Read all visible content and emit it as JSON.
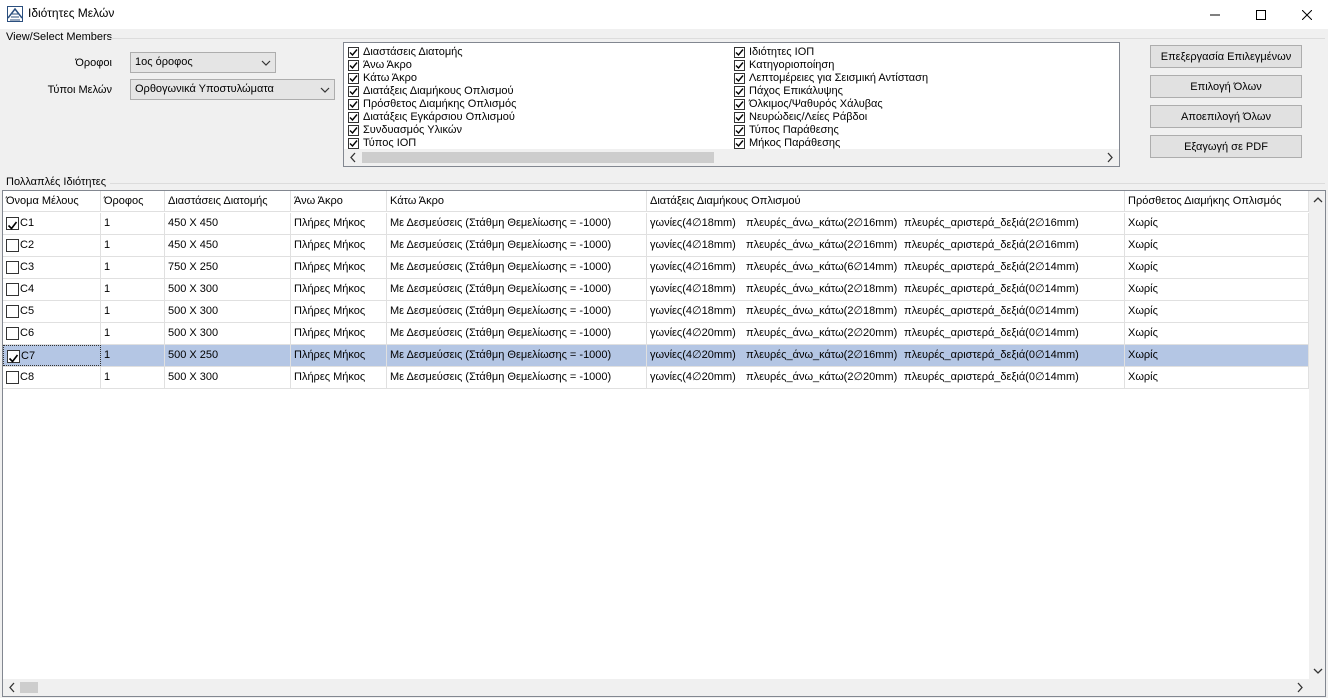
{
  "window": {
    "title": "Ιδιότητες Μελών"
  },
  "view_select": {
    "group_label": "View/Select Members",
    "floors_label": "Όροφοι",
    "floors_value": "1ος όροφος",
    "member_types_label": "Τύποι Μελών",
    "member_types_value": "Ορθογωνικά Υποστυλώματα"
  },
  "property_checklist": {
    "left": [
      {
        "label": "Διαστάσεις Διατομής",
        "checked": true
      },
      {
        "label": "Άνω Άκρο",
        "checked": true
      },
      {
        "label": "Κάτω Άκρο",
        "checked": true
      },
      {
        "label": "Διατάξεις Διαμήκους Οπλισμού",
        "checked": true
      },
      {
        "label": "Πρόσθετος Διαμήκης Οπλισμός",
        "checked": true
      },
      {
        "label": "Διατάξεις Εγκάρσιου Οπλισμού",
        "checked": true
      },
      {
        "label": "Συνδυασμός Υλικών",
        "checked": true
      },
      {
        "label": "Τύπος ΙΟΠ",
        "checked": true
      }
    ],
    "right": [
      {
        "label": "Ιδιότητες ΙΟΠ",
        "checked": true
      },
      {
        "label": "Κατηγοριοποίηση",
        "checked": true
      },
      {
        "label": "Λεπτομέρειες για Σεισμική Αντίσταση",
        "checked": true
      },
      {
        "label": "Πάχος Επικάλυψης",
        "checked": true
      },
      {
        "label": "Όλκιμος/Ψαθυρός Χάλυβας",
        "checked": true
      },
      {
        "label": "Νευρώδεις/Λείες Ράβδοι",
        "checked": true
      },
      {
        "label": "Τύπος Παράθεσης",
        "checked": true
      },
      {
        "label": "Μήκος Παράθεσης",
        "checked": true
      }
    ]
  },
  "actions": {
    "edit_selected": "Επεξεργασία Επιλεγμένων",
    "select_all": "Επιλογή Όλων",
    "deselect_all": "Αποεπιλογή Όλων",
    "export_pdf": "Εξαγωγή σε PDF"
  },
  "multiple_properties": {
    "group_label": "Πολλαπλές Ιδιότητες",
    "columns": [
      "Όνομα Μέλους",
      "Όροφος",
      "Διαστάσεις Διατομής",
      "Άνω Άκρο",
      "Κάτω Άκρο",
      "Διατάξεις Διαμήκους Οπλισμού",
      "Πρόσθετος Διαμήκης Οπλισμός"
    ],
    "rows": [
      {
        "name": "C1",
        "checked": true,
        "floor": "1",
        "section": "450 X 450",
        "top": "Πλήρες Μήκος",
        "bottom": "Με Δεσμεύσεις (Στάθμη Θεμελίωσης = -1000)",
        "corners": "γωνίες(4∅18mm)",
        "top_bottom": "πλευρές_άνω_κάτω(2∅16mm)",
        "left_right": "πλευρές_αριστερά_δεξιά(2∅16mm)",
        "extra": "Χωρίς",
        "selected": false
      },
      {
        "name": "C2",
        "checked": false,
        "floor": "1",
        "section": "450 X 450",
        "top": "Πλήρες Μήκος",
        "bottom": "Με Δεσμεύσεις (Στάθμη Θεμελίωσης = -1000)",
        "corners": "γωνίες(4∅18mm)",
        "top_bottom": "πλευρές_άνω_κάτω(2∅16mm)",
        "left_right": "πλευρές_αριστερά_δεξιά(2∅16mm)",
        "extra": "Χωρίς",
        "selected": false
      },
      {
        "name": "C3",
        "checked": false,
        "floor": "1",
        "section": "750 X 250",
        "top": "Πλήρες Μήκος",
        "bottom": "Με Δεσμεύσεις (Στάθμη Θεμελίωσης = -1000)",
        "corners": "γωνίες(4∅16mm)",
        "top_bottom": "πλευρές_άνω_κάτω(6∅14mm)",
        "left_right": "πλευρές_αριστερά_δεξιά(2∅14mm)",
        "extra": "Χωρίς",
        "selected": false
      },
      {
        "name": "C4",
        "checked": false,
        "floor": "1",
        "section": "500 X 300",
        "top": "Πλήρες Μήκος",
        "bottom": "Με Δεσμεύσεις (Στάθμη Θεμελίωσης = -1000)",
        "corners": "γωνίες(4∅18mm)",
        "top_bottom": "πλευρές_άνω_κάτω(2∅18mm)",
        "left_right": "πλευρές_αριστερά_δεξιά(0∅14mm)",
        "extra": "Χωρίς",
        "selected": false
      },
      {
        "name": "C5",
        "checked": false,
        "floor": "1",
        "section": "500 X 300",
        "top": "Πλήρες Μήκος",
        "bottom": "Με Δεσμεύσεις (Στάθμη Θεμελίωσης = -1000)",
        "corners": "γωνίες(4∅18mm)",
        "top_bottom": "πλευρές_άνω_κάτω(2∅18mm)",
        "left_right": "πλευρές_αριστερά_δεξιά(0∅14mm)",
        "extra": "Χωρίς",
        "selected": false
      },
      {
        "name": "C6",
        "checked": false,
        "floor": "1",
        "section": "500 X 300",
        "top": "Πλήρες Μήκος",
        "bottom": "Με Δεσμεύσεις (Στάθμη Θεμελίωσης = -1000)",
        "corners": "γωνίες(4∅20mm)",
        "top_bottom": "πλευρές_άνω_κάτω(2∅20mm)",
        "left_right": "πλευρές_αριστερά_δεξιά(0∅14mm)",
        "extra": "Χωρίς",
        "selected": false
      },
      {
        "name": "C7",
        "checked": true,
        "floor": "1",
        "section": "500 X 250",
        "top": "Πλήρες Μήκος",
        "bottom": "Με Δεσμεύσεις (Στάθμη Θεμελίωσης = -1000)",
        "corners": "γωνίες(4∅20mm)",
        "top_bottom": "πλευρές_άνω_κάτω(2∅16mm)",
        "left_right": "πλευρές_αριστερά_δεξιά(0∅14mm)",
        "extra": "Χωρίς",
        "selected": true
      },
      {
        "name": "C8",
        "checked": false,
        "floor": "1",
        "section": "500 X 300",
        "top": "Πλήρες Μήκος",
        "bottom": "Με Δεσμεύσεις (Στάθμη Θεμελίωσης = -1000)",
        "corners": "γωνίες(4∅20mm)",
        "top_bottom": "πλευρές_άνω_κάτω(2∅20mm)",
        "left_right": "πλευρές_αριστερά_δεξιά(0∅14mm)",
        "extra": "Χωρίς",
        "selected": false
      }
    ]
  },
  "colors": {
    "selected_row": "#b4c6e4",
    "button_face": "#e1e1e1",
    "window_bg": "#f0f0f0"
  }
}
